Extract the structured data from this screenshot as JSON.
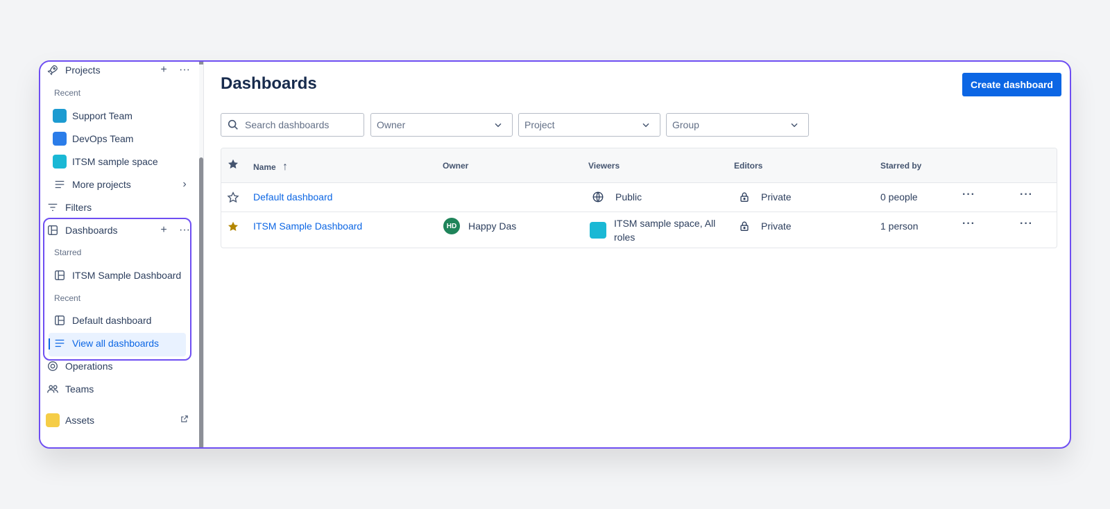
{
  "sidebar": {
    "projects": "Projects",
    "recent_label": "Recent",
    "recent_projects": [
      "Support Team",
      "DevOps Team",
      "ITSM sample space"
    ],
    "more_projects": "More projects",
    "filters": "Filters",
    "dashboards": "Dashboards",
    "starred_label": "Starred",
    "starred_dashboard": "ITSM Sample Dashboard",
    "recent_dash_label": "Recent",
    "recent_dashboard": "Default dashboard",
    "view_all": "View all dashboards",
    "operations": "Operations",
    "teams": "Teams",
    "assets": "Assets",
    "plus": "+",
    "more": "···"
  },
  "main": {
    "title": "Dashboards",
    "create_button": "Create dashboard",
    "search_placeholder": "Search dashboards",
    "filters": [
      "Owner",
      "Project",
      "Group"
    ]
  },
  "table": {
    "columns": [
      "Name",
      "Owner",
      "Viewers",
      "Editors",
      "Starred by"
    ],
    "rows": [
      {
        "name": "Default dashboard",
        "owner": "",
        "owner_initials": "",
        "viewers": "Public",
        "editors": "Private",
        "starred_by": "0 people",
        "starred": false
      },
      {
        "name": "ITSM Sample Dashboard",
        "owner": "Happy Das",
        "owner_initials": "HD",
        "viewers": "ITSM sample space, All roles",
        "editors": "Private",
        "starred_by": "1 person",
        "starred": true
      }
    ],
    "more": "···"
  },
  "colors": {
    "accent": "#0c66e4",
    "highlight": "#6e4ef2",
    "star": "#b38600",
    "avatar": "#1f845a"
  }
}
